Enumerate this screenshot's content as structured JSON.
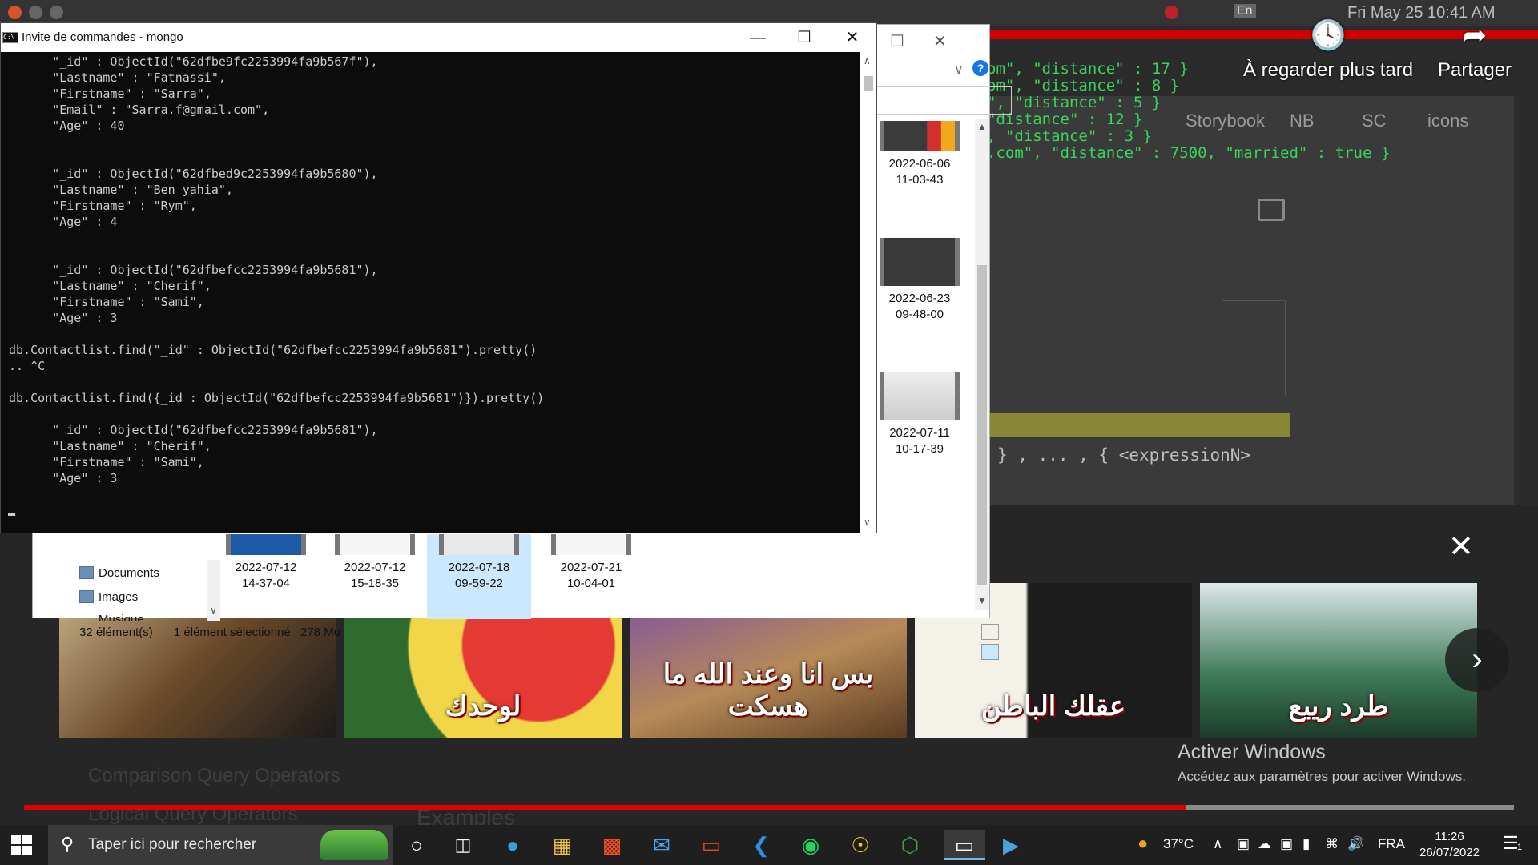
{
  "background": {
    "os_bar": {
      "language": "En",
      "clock": "Fri May 25  10:41 AM"
    },
    "code_lines": [
      "om\", \"distance\" : 17 }",
      "om\", \"distance\" : 8 }",
      "\", \"distance\" : 5 }",
      "\"distance\" : 12 }",
      ", \"distance\" : 3 }",
      ".com\", \"distance\" : 7500, \"married\" : true }"
    ],
    "bookmarks": [
      "Storybook",
      "NB",
      "SC",
      "icons"
    ],
    "expression": "} , ... , { <expressionN>",
    "faded_menu": [
      "Comparison Query Operators",
      "Logical Query Operators"
    ],
    "faded_heading": "Examples"
  },
  "youtube": {
    "watch_later": "À regarder plus tard",
    "share": "Partager",
    "thumbnails": [
      {
        "text": ""
      },
      {
        "text": "لوحدك"
      },
      {
        "text": "بس انا وعند الله ما هسكت"
      },
      {
        "text": "عقلك الباطن"
      },
      {
        "text": "طرد رييع"
      }
    ],
    "progress_fraction": 0.78
  },
  "windows_activation": {
    "title": "Activer Windows",
    "subtitle": "Accédez aux paramètres pour activer Windows."
  },
  "explorer": {
    "files_right": [
      {
        "date": "2022-06-06",
        "time": "11-03-43"
      },
      {
        "date": "2022-06-23",
        "time": "09-48-00"
      },
      {
        "date": "2022-07-11",
        "time": "10-17-39"
      }
    ],
    "files_bottom": [
      {
        "date": "2022-07-12",
        "time": "14-37-04",
        "selected": false
      },
      {
        "date": "2022-07-12",
        "time": "15-18-35",
        "selected": false
      },
      {
        "date": "2022-07-18",
        "time": "09-59-22",
        "selected": true
      },
      {
        "date": "2022-07-21",
        "time": "10-04-01",
        "selected": false
      }
    ],
    "nav": [
      "Documents",
      "Images",
      "Musique"
    ],
    "status": {
      "count": "32 élément(s)",
      "selected": "1 élément sélectionné",
      "size": "278 Mo"
    }
  },
  "cmd": {
    "title": "Invite de commandes - mongo",
    "lines": [
      "      \"_id\" : ObjectId(\"62dfbe9fc2253994fa9b567f\"),",
      "      \"Lastname\" : \"Fatnassi\",",
      "      \"Firstname\" : \"Sarra\",",
      "      \"Email\" : \"Sarra.f@gmail.com\",",
      "      \"Age\" : 40",
      "",
      "",
      "      \"_id\" : ObjectId(\"62dfbed9c2253994fa9b5680\"),",
      "      \"Lastname\" : \"Ben yahia\",",
      "      \"Firstname\" : \"Rym\",",
      "      \"Age\" : 4",
      "",
      "",
      "      \"_id\" : ObjectId(\"62dfbefcc2253994fa9b5681\"),",
      "      \"Lastname\" : \"Cherif\",",
      "      \"Firstname\" : \"Sami\",",
      "      \"Age\" : 3",
      "",
      "db.Contactlist.find(\"_id\" : ObjectId(\"62dfbefcc2253994fa9b5681\").pretty()",
      ".. ^C",
      "",
      "db.Contactlist.find({_id : ObjectId(\"62dfbefcc2253994fa9b5681\")}).pretty()",
      "",
      "      \"_id\" : ObjectId(\"62dfbefcc2253994fa9b5681\"),",
      "      \"Lastname\" : \"Cherif\",",
      "      \"Firstname\" : \"Sami\",",
      "      \"Age\" : 3"
    ]
  },
  "taskbar": {
    "search_placeholder": "Taper ici pour rechercher",
    "apps": [
      "task-view",
      "edge",
      "file-explorer",
      "store",
      "mail",
      "office",
      "vscode",
      "spotify",
      "chrome",
      "node",
      "cmd",
      "video-player"
    ],
    "weather": "37°C",
    "language": "FRA",
    "time": "11:26",
    "date": "26/07/2022",
    "notifications": "1"
  }
}
